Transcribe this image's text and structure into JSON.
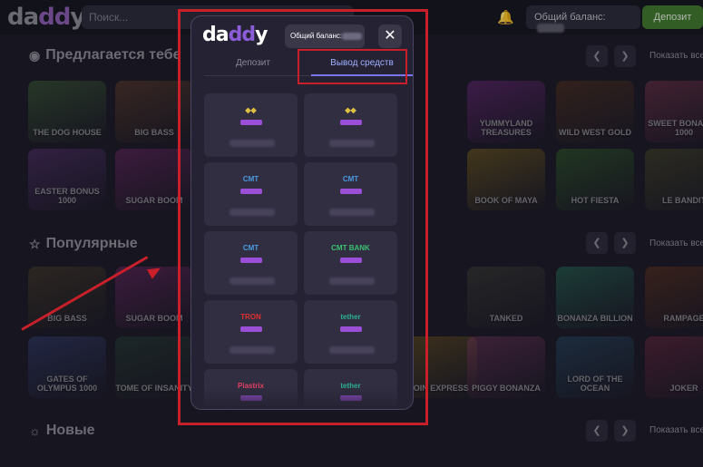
{
  "header": {
    "logo_text": "daddy",
    "search_placeholder": "Поиск...",
    "balance_label": "Общий баланс:",
    "deposit_button": "Депозит"
  },
  "sections": [
    {
      "title": "Предлагается тебе",
      "show_all": "Показать все"
    },
    {
      "title": "Популярные",
      "show_all": "Показать все"
    },
    {
      "title": "Новые",
      "show_all": "Показать все"
    }
  ],
  "games": [
    {
      "title": "THE DOG HOUSE",
      "color": "#4a7a3a"
    },
    {
      "title": "BIG BASS",
      "color": "#7a4a2a"
    },
    {
      "title": "YUMMYLAND TREASURES",
      "color": "#8a2a9a"
    },
    {
      "title": "WILD WEST GOLD",
      "color": "#6a3a1a"
    },
    {
      "title": "SWEET BONANZA 1000",
      "color": "#9a3a5a"
    },
    {
      "title": "EASTER BONUS 1000",
      "color": "#6a3a8a"
    },
    {
      "title": "SUGAR BOOM",
      "color": "#8a2a7a"
    },
    {
      "title": "BOOK OF MAYA",
      "color": "#9a7a1a"
    },
    {
      "title": "HOT FIESTA",
      "color": "#3a7a2a"
    },
    {
      "title": "LE BANDIT",
      "color": "#5a5a2a"
    },
    {
      "title": "BIG BASS",
      "color": "#5a4a2a"
    },
    {
      "title": "SUGAR BOOM",
      "color": "#8a2a7a"
    },
    {
      "title": "TANKED",
      "color": "#4a4a3a"
    },
    {
      "title": "BONANZA BILLION",
      "color": "#2a8a6a"
    },
    {
      "title": "RAMPAGE",
      "color": "#7a3a1a"
    },
    {
      "title": "GATES OF OLYMPUS 1000",
      "color": "#3a4a8a"
    },
    {
      "title": "TOME OF INSANITY",
      "color": "#2a4a3a"
    },
    {
      "title": "COIN EXPRESS",
      "color": "#8a6a1a"
    },
    {
      "title": "PIGGY BONANZA",
      "color": "#8a3a6a"
    },
    {
      "title": "LORD OF THE OCEAN",
      "color": "#2a5a7a"
    },
    {
      "title": "JOKER",
      "color": "#8a2a4a"
    }
  ],
  "modal": {
    "logo_text": "daddy",
    "balance_label": "Общий баланс:",
    "close_icon": "close-icon",
    "tabs": [
      "Депозит",
      "Вывод средств"
    ],
    "active_tab": "Вывод средств",
    "methods": [
      {
        "name": "",
        "color": "#e0c040"
      },
      {
        "name": "",
        "color": "#e0c040"
      },
      {
        "name": "CMT",
        "color": "#4a9ae0"
      },
      {
        "name": "CMT",
        "color": "#4a9ae0"
      },
      {
        "name": "CMT",
        "color": "#4a9ae0"
      },
      {
        "name": "CMT BANK",
        "color": "#3ac070"
      },
      {
        "name": "TRON",
        "color": "#e03030"
      },
      {
        "name": "tether",
        "color": "#2ab090"
      },
      {
        "name": "Piastrix",
        "color": "#e04060"
      },
      {
        "name": "tether",
        "color": "#2ab090"
      }
    ]
  },
  "colors": {
    "accent_red": "#c8202a",
    "deposit_green": "#3f7a2d",
    "tab_active": "#7b74f0"
  }
}
